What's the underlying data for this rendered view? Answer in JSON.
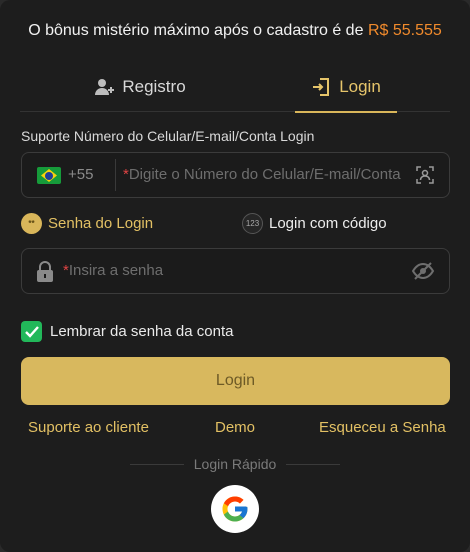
{
  "bonus": {
    "text": "O bônus mistério máximo após o cadastro é de",
    "amount": "R$ 55.555"
  },
  "tabs": {
    "register": "Registro",
    "login": "Login",
    "active": "login"
  },
  "phone_field": {
    "label": "Suporte Número do Celular/E-mail/Conta Login",
    "country_code": "+55",
    "required_mark": "*",
    "placeholder": "Digite o Número do Celular/E-mail/Conta"
  },
  "login_modes": {
    "password": "Senha do Login",
    "code": "Login com código",
    "code_icon_text": "123",
    "password_icon_text": "**"
  },
  "password_field": {
    "required_mark": "*",
    "placeholder": "Insira a senha"
  },
  "remember": {
    "label": "Lembrar da senha da conta",
    "checked": true
  },
  "submit": {
    "label": "Login"
  },
  "links": {
    "support": "Suporte ao cliente",
    "demo": "Demo",
    "forgot": "Esqueceu a Senha"
  },
  "quick_login": {
    "label": "Login Rápido",
    "providers": [
      "google-icon"
    ]
  },
  "colors": {
    "accent": "#d9b65a",
    "amount": "#f08a2c",
    "check": "#22b85a",
    "background": "#1d1d1d"
  }
}
